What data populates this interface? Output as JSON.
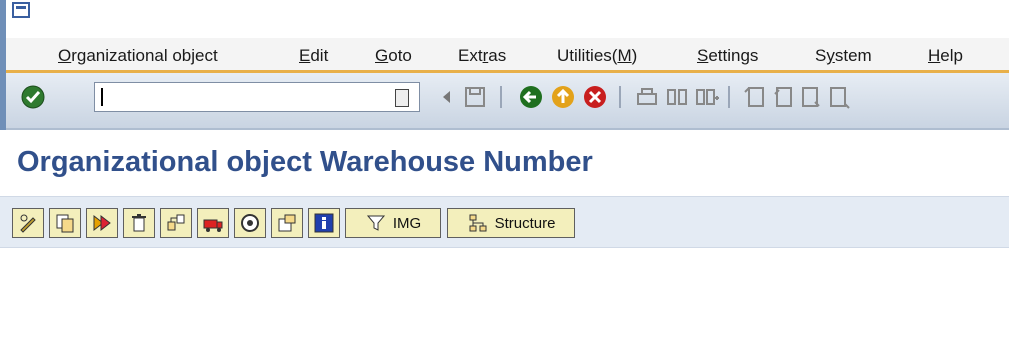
{
  "menu": {
    "items": [
      {
        "label": "Organizational object",
        "underline": "O"
      },
      {
        "label": "Edit",
        "underline": "E"
      },
      {
        "label": "Goto",
        "underline": "G"
      },
      {
        "label": "Extras",
        "underline": "r"
      },
      {
        "label": "Utilities(M)",
        "underline": "M"
      },
      {
        "label": "Settings",
        "underline": "S"
      },
      {
        "label": "System",
        "underline": "y"
      },
      {
        "label": "Help",
        "underline": "H"
      }
    ]
  },
  "toolbar": {
    "command_value": "",
    "icons": [
      "enter-check-icon",
      "history-dropdown-icon",
      "back-triangle-icon",
      "save-icon",
      "back-green-icon",
      "exit-up-icon",
      "cancel-icon",
      "print-icon",
      "find-icon",
      "find-next-icon",
      "first-page-icon",
      "previous-page-icon",
      "next-page-icon",
      "last-page-icon"
    ]
  },
  "page": {
    "title": "Organizational object Warehouse Number"
  },
  "appbar": {
    "img_label": "IMG",
    "structure_label": "Structure",
    "icons": [
      "change-pencil-icon",
      "copy-icon",
      "display-icon",
      "delete-icon",
      "create-icon",
      "transport-icon",
      "where-used-icon",
      "export-icon",
      "info-icon",
      "img-filter-icon",
      "structure-icon"
    ]
  },
  "colors": {
    "title": "#31508b",
    "menu_accent": "#e8b04a",
    "button_bg": "#f3efbc"
  }
}
